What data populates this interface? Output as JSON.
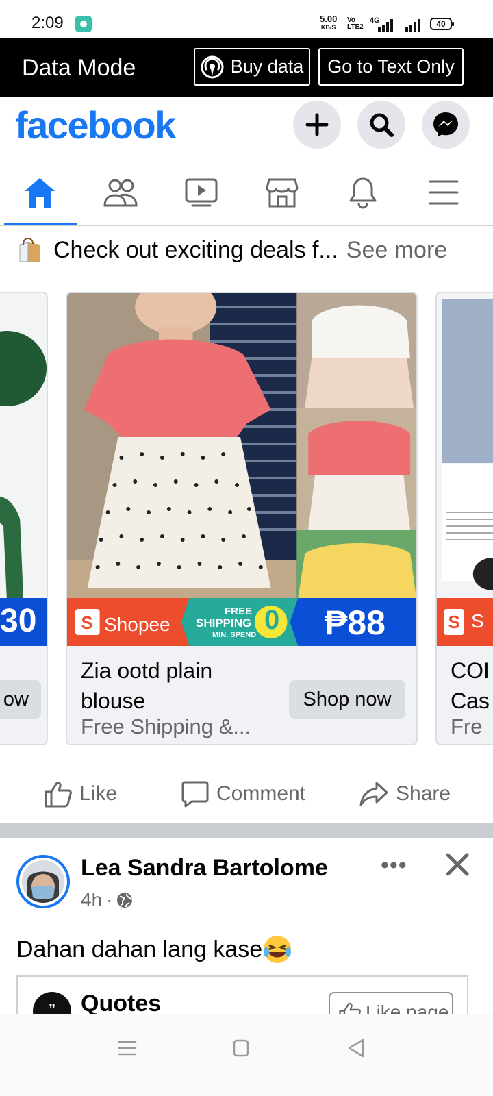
{
  "status_bar": {
    "time": "2:09",
    "speed_value": "5.00",
    "speed_unit": "KB/S",
    "volte": "Vo LTE2",
    "network": "4G",
    "battery": "40"
  },
  "data_mode": {
    "title": "Data Mode",
    "buy_data_label": "Buy data",
    "text_only_label": "Go to Text Only"
  },
  "header": {
    "logo": "facebook",
    "icons": [
      "plus-icon",
      "search-icon",
      "messenger-icon"
    ]
  },
  "nav": {
    "tabs": [
      "home-icon",
      "friends-icon",
      "watch-icon",
      "marketplace-icon",
      "notifications-icon",
      "menu-icon"
    ],
    "active": "home"
  },
  "ad": {
    "headline": "Check out exciting deals f...",
    "see_more": "See more",
    "left_card": {
      "price_partial": "30",
      "button_partial": "ow"
    },
    "main_card": {
      "brand": "Shopee",
      "shipping_line1": "FREE",
      "shipping_line2": "SHIPPING",
      "shipping_note": "MIN. SPEND",
      "shipping_value": "0",
      "price": "₱88",
      "title": "Zia ootd plain blouse",
      "subtitle": "Free Shipping &...",
      "button": "Shop now"
    },
    "right_card": {
      "brand_partial": "S",
      "title_line1": "COI",
      "title_line2": "Cas",
      "subtitle_partial": "Fre"
    }
  },
  "actions": {
    "like": "Like",
    "comment": "Comment",
    "share": "Share"
  },
  "post": {
    "author": "Lea Sandra Bartolome",
    "time": "4h",
    "separator": "·",
    "text": "Dahan dahan lang kase",
    "shared_page": "Quotes",
    "shared_page_logo": "”",
    "like_page": "Like page"
  },
  "colors": {
    "facebook_blue": "#1877f2",
    "shopee_orange": "#ee4d2d",
    "price_blue": "#0a4fd6",
    "shipping_teal": "#26aa99"
  }
}
